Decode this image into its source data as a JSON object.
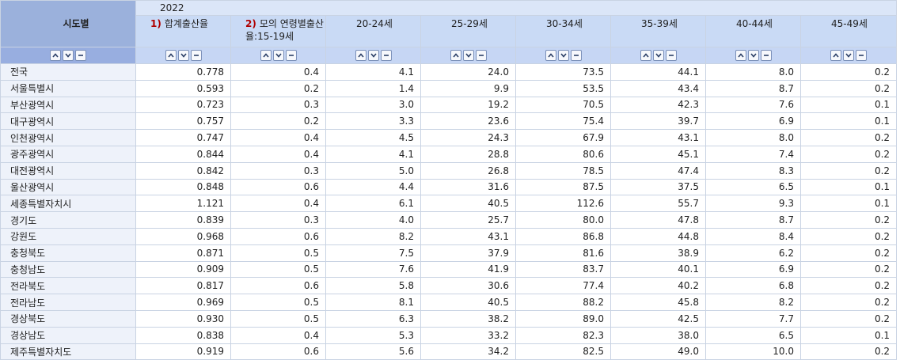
{
  "header": {
    "row_label": "시도별",
    "year": "2022",
    "columns": [
      {
        "note": "1)",
        "label": "합계출산율"
      },
      {
        "note": "2)",
        "label": "모의 연령별출산",
        "label2": "율:15-19세"
      },
      {
        "note": "",
        "label": "20-24세"
      },
      {
        "note": "",
        "label": "25-29세"
      },
      {
        "note": "",
        "label": "30-34세"
      },
      {
        "note": "",
        "label": "35-39세"
      },
      {
        "note": "",
        "label": "40-44세"
      },
      {
        "note": "",
        "label": "45-49세"
      }
    ]
  },
  "icons": [
    "sort-up-icon",
    "sort-down-icon",
    "minus-icon"
  ],
  "rows": [
    {
      "region": "전국",
      "values": [
        "0.778",
        "0.4",
        "4.1",
        "24.0",
        "73.5",
        "44.1",
        "8.0",
        "0.2"
      ]
    },
    {
      "region": "서울특별시",
      "values": [
        "0.593",
        "0.2",
        "1.4",
        "9.9",
        "53.5",
        "43.4",
        "8.7",
        "0.2"
      ]
    },
    {
      "region": "부산광역시",
      "values": [
        "0.723",
        "0.3",
        "3.0",
        "19.2",
        "70.5",
        "42.3",
        "7.6",
        "0.1"
      ]
    },
    {
      "region": "대구광역시",
      "values": [
        "0.757",
        "0.2",
        "3.3",
        "23.6",
        "75.4",
        "39.7",
        "6.9",
        "0.1"
      ]
    },
    {
      "region": "인천광역시",
      "values": [
        "0.747",
        "0.4",
        "4.5",
        "24.3",
        "67.9",
        "43.1",
        "8.0",
        "0.2"
      ]
    },
    {
      "region": "광주광역시",
      "values": [
        "0.844",
        "0.4",
        "4.1",
        "28.8",
        "80.6",
        "45.1",
        "7.4",
        "0.2"
      ]
    },
    {
      "region": "대전광역시",
      "values": [
        "0.842",
        "0.3",
        "5.0",
        "26.8",
        "78.5",
        "47.4",
        "8.3",
        "0.2"
      ]
    },
    {
      "region": "울산광역시",
      "values": [
        "0.848",
        "0.6",
        "4.4",
        "31.6",
        "87.5",
        "37.5",
        "6.5",
        "0.1"
      ]
    },
    {
      "region": "세종특별자치시",
      "values": [
        "1.121",
        "0.4",
        "6.1",
        "40.5",
        "112.6",
        "55.7",
        "9.3",
        "0.1"
      ]
    },
    {
      "region": "경기도",
      "values": [
        "0.839",
        "0.3",
        "4.0",
        "25.7",
        "80.0",
        "47.8",
        "8.7",
        "0.2"
      ]
    },
    {
      "region": "강원도",
      "values": [
        "0.968",
        "0.6",
        "8.2",
        "43.1",
        "86.8",
        "44.8",
        "8.4",
        "0.2"
      ]
    },
    {
      "region": "충청북도",
      "values": [
        "0.871",
        "0.5",
        "7.5",
        "37.9",
        "81.6",
        "38.9",
        "6.2",
        "0.2"
      ]
    },
    {
      "region": "충청남도",
      "values": [
        "0.909",
        "0.5",
        "7.6",
        "41.9",
        "83.7",
        "40.1",
        "6.9",
        "0.2"
      ]
    },
    {
      "region": "전라북도",
      "values": [
        "0.817",
        "0.6",
        "5.8",
        "30.6",
        "77.4",
        "40.2",
        "6.8",
        "0.2"
      ]
    },
    {
      "region": "전라남도",
      "values": [
        "0.969",
        "0.5",
        "8.1",
        "40.5",
        "88.2",
        "45.8",
        "8.2",
        "0.2"
      ]
    },
    {
      "region": "경상북도",
      "values": [
        "0.930",
        "0.5",
        "6.3",
        "38.2",
        "89.0",
        "42.5",
        "7.7",
        "0.2"
      ]
    },
    {
      "region": "경상남도",
      "values": [
        "0.838",
        "0.4",
        "5.3",
        "33.2",
        "82.3",
        "38.0",
        "6.5",
        "0.1"
      ]
    },
    {
      "region": "제주특별자치도",
      "values": [
        "0.919",
        "0.6",
        "5.6",
        "34.2",
        "82.5",
        "49.0",
        "10.0",
        "0.2"
      ]
    }
  ]
}
